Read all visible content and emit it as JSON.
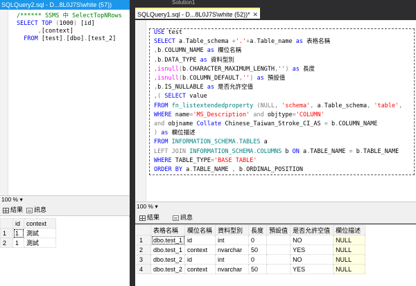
{
  "left_pane": {
    "tab_title": "SQLQuery2.sql - D...8L0J7S\\white (57))",
    "code": [
      [
        {
          "t": "/****** SSMS 中 SelectTopNRows",
          "c": "cm"
        }
      ],
      [
        {
          "t": "SELECT TOP ",
          "c": "kw"
        },
        {
          "t": "(",
          "c": "gr"
        },
        {
          "t": "1000",
          "c": "txt"
        },
        {
          "t": ") ",
          "c": "gr"
        },
        {
          "t": "[id]",
          "c": "txt"
        }
      ],
      [
        {
          "t": "      ,",
          "c": "gr"
        },
        {
          "t": "[context]",
          "c": "txt"
        }
      ],
      [
        {
          "t": "  FROM ",
          "c": "kw"
        },
        {
          "t": "[test]",
          "c": "txt"
        },
        {
          "t": ".",
          "c": "gr"
        },
        {
          "t": "[dbo]",
          "c": "txt"
        },
        {
          "t": ".",
          "c": "gr"
        },
        {
          "t": "[test_2]",
          "c": "txt"
        }
      ]
    ],
    "zoom": "100 %",
    "results_tab": "結果",
    "messages_tab": "訊息",
    "grid": {
      "columns": [
        "id",
        "context"
      ],
      "rows": [
        [
          "1",
          "1",
          "測試"
        ],
        [
          "2",
          "1",
          "測試"
        ]
      ]
    }
  },
  "right_pane": {
    "window_title": "Solution1",
    "tab_title": "SQLQuery1.sql - D...8L0J7S\\white (52))*",
    "tab_close": "✕",
    "code": [
      [
        {
          "t": "USE ",
          "c": "kw"
        },
        {
          "t": "test",
          "c": "txt"
        }
      ],
      [
        {
          "t": "SELECT ",
          "c": "kw"
        },
        {
          "t": "a",
          "c": "txt"
        },
        {
          "t": ".",
          "c": "gr"
        },
        {
          "t": "Table_schema ",
          "c": "txt"
        },
        {
          "t": "+",
          "c": "gr"
        },
        {
          "t": "'.'",
          "c": "str"
        },
        {
          "t": "+",
          "c": "gr"
        },
        {
          "t": "a",
          "c": "txt"
        },
        {
          "t": ".",
          "c": "gr"
        },
        {
          "t": "Table_name ",
          "c": "txt"
        },
        {
          "t": "as ",
          "c": "kw"
        },
        {
          "t": "表格名稱",
          "c": "txt"
        }
      ],
      [
        {
          "t": ",",
          "c": "gr"
        },
        {
          "t": "b",
          "c": "txt"
        },
        {
          "t": ".",
          "c": "gr"
        },
        {
          "t": "COLUMN_NAME ",
          "c": "txt"
        },
        {
          "t": "as ",
          "c": "kw"
        },
        {
          "t": "欄位名稱",
          "c": "txt"
        }
      ],
      [
        {
          "t": ",",
          "c": "gr"
        },
        {
          "t": "b",
          "c": "txt"
        },
        {
          "t": ".",
          "c": "gr"
        },
        {
          "t": "DATA_TYPE ",
          "c": "txt"
        },
        {
          "t": "as ",
          "c": "kw"
        },
        {
          "t": "資料型別",
          "c": "txt"
        }
      ],
      [
        {
          "t": ",",
          "c": "gr"
        },
        {
          "t": "isnull",
          "c": "fn"
        },
        {
          "t": "(",
          "c": "gr"
        },
        {
          "t": "b",
          "c": "txt"
        },
        {
          "t": ".",
          "c": "gr"
        },
        {
          "t": "CHARACTER_MAXIMUM_LENGTH",
          "c": "txt"
        },
        {
          "t": ",",
          "c": "gr"
        },
        {
          "t": "''",
          "c": "str"
        },
        {
          "t": ") ",
          "c": "gr"
        },
        {
          "t": "as ",
          "c": "kw"
        },
        {
          "t": "長度",
          "c": "txt"
        }
      ],
      [
        {
          "t": ",",
          "c": "gr"
        },
        {
          "t": "isnull",
          "c": "fn"
        },
        {
          "t": "(",
          "c": "gr"
        },
        {
          "t": "b",
          "c": "txt"
        },
        {
          "t": ".",
          "c": "gr"
        },
        {
          "t": "COLUMN_DEFAULT",
          "c": "txt"
        },
        {
          "t": ",",
          "c": "gr"
        },
        {
          "t": "''",
          "c": "str"
        },
        {
          "t": ") ",
          "c": "gr"
        },
        {
          "t": "as ",
          "c": "kw"
        },
        {
          "t": "預設值",
          "c": "txt"
        }
      ],
      [
        {
          "t": ",",
          "c": "gr"
        },
        {
          "t": "b",
          "c": "txt"
        },
        {
          "t": ".",
          "c": "gr"
        },
        {
          "t": "IS_NULLABLE ",
          "c": "txt"
        },
        {
          "t": "as ",
          "c": "kw"
        },
        {
          "t": "是否允許空值",
          "c": "txt"
        }
      ],
      [
        {
          "t": ",",
          "c": "gr"
        },
        {
          "t": "( ",
          "c": "gr"
        },
        {
          "t": "SELECT ",
          "c": "kw"
        },
        {
          "t": "value",
          "c": "txt"
        }
      ],
      [
        {
          "t": "FROM ",
          "c": "kw"
        },
        {
          "t": "fn_listextendedproperty ",
          "c": "sys"
        },
        {
          "t": "(",
          "c": "gr"
        },
        {
          "t": "NULL",
          "c": "gr"
        },
        {
          "t": ", ",
          "c": "gr"
        },
        {
          "t": "'schema'",
          "c": "str"
        },
        {
          "t": ", ",
          "c": "gr"
        },
        {
          "t": "a",
          "c": "txt"
        },
        {
          "t": ".",
          "c": "gr"
        },
        {
          "t": "Table_schema",
          "c": "txt"
        },
        {
          "t": ", ",
          "c": "gr"
        },
        {
          "t": "'table'",
          "c": "str"
        },
        {
          "t": ",",
          "c": "gr"
        }
      ],
      [
        {
          "t": "WHERE ",
          "c": "kw"
        },
        {
          "t": "name",
          "c": "txt"
        },
        {
          "t": "=",
          "c": "gr"
        },
        {
          "t": "'MS_Description'",
          "c": "str"
        },
        {
          "t": " and ",
          "c": "gr"
        },
        {
          "t": "objtype",
          "c": "txt"
        },
        {
          "t": "=",
          "c": "gr"
        },
        {
          "t": "'COLUMN'",
          "c": "str"
        }
      ],
      [
        {
          "t": "and ",
          "c": "gr"
        },
        {
          "t": "objname ",
          "c": "txt"
        },
        {
          "t": "Collate ",
          "c": "kw"
        },
        {
          "t": "Chinese_Taiwan_Stroke_CI_AS ",
          "c": "txt"
        },
        {
          "t": "= ",
          "c": "gr"
        },
        {
          "t": "b",
          "c": "txt"
        },
        {
          "t": ".",
          "c": "gr"
        },
        {
          "t": "COLUMN_NAME",
          "c": "txt"
        }
      ],
      [
        {
          "t": ") ",
          "c": "gr"
        },
        {
          "t": "as ",
          "c": "kw"
        },
        {
          "t": "欄位描述",
          "c": "txt"
        }
      ],
      [
        {
          "t": "FROM ",
          "c": "kw"
        },
        {
          "t": "INFORMATION_SCHEMA",
          "c": "sys"
        },
        {
          "t": ".",
          "c": "gr"
        },
        {
          "t": "TABLES ",
          "c": "sys"
        },
        {
          "t": "a",
          "c": "txt"
        }
      ],
      [
        {
          "t": "LEFT JOIN ",
          "c": "gr"
        },
        {
          "t": "INFORMATION_SCHEMA",
          "c": "sys"
        },
        {
          "t": ".",
          "c": "gr"
        },
        {
          "t": "COLUMNS ",
          "c": "sys"
        },
        {
          "t": "b ",
          "c": "txt"
        },
        {
          "t": "ON ",
          "c": "kw"
        },
        {
          "t": "a",
          "c": "txt"
        },
        {
          "t": ".",
          "c": "gr"
        },
        {
          "t": "TABLE_NAME ",
          "c": "txt"
        },
        {
          "t": "= ",
          "c": "gr"
        },
        {
          "t": "b",
          "c": "txt"
        },
        {
          "t": ".",
          "c": "gr"
        },
        {
          "t": "TABLE_NAME",
          "c": "txt"
        }
      ],
      [
        {
          "t": "WHERE ",
          "c": "kw"
        },
        {
          "t": "TABLE_TYPE",
          "c": "txt"
        },
        {
          "t": "=",
          "c": "gr"
        },
        {
          "t": "'BASE TABLE'",
          "c": "str"
        }
      ],
      [
        {
          "t": "ORDER BY ",
          "c": "kw"
        },
        {
          "t": "a",
          "c": "txt"
        },
        {
          "t": ".",
          "c": "gr"
        },
        {
          "t": "TABLE_NAME ",
          "c": "txt"
        },
        {
          "t": ", ",
          "c": "gr"
        },
        {
          "t": "b",
          "c": "txt"
        },
        {
          "t": ".",
          "c": "gr"
        },
        {
          "t": "ORDINAL_POSITION",
          "c": "txt"
        }
      ]
    ],
    "zoom": "100 %",
    "results_tab": "結果",
    "messages_tab": "訊息",
    "grid": {
      "columns": [
        "表格名稱",
        "欄位名稱",
        "資料型別",
        "長度",
        "預設值",
        "是否允許空值",
        "欄位描述"
      ],
      "rows": [
        [
          "1",
          "dbo.test_1",
          "id",
          "int",
          "0",
          "",
          "NO",
          "NULL"
        ],
        [
          "2",
          "dbo.test_1",
          "context",
          "nvarchar",
          "50",
          "",
          "YES",
          "NULL"
        ],
        [
          "3",
          "dbo.test_2",
          "id",
          "int",
          "0",
          "",
          "NO",
          "NULL"
        ],
        [
          "4",
          "dbo.test_2",
          "context",
          "nvarchar",
          "50",
          "",
          "YES",
          "NULL"
        ]
      ]
    }
  },
  "colors": {
    "keyword": "#0000ff",
    "string": "#ff0000",
    "function": "#ff00ff",
    "system_object": "#008080",
    "operator": "#808080",
    "comment": "#008000",
    "active_tab": "#1c97ea",
    "null_cell": "#ffffe1"
  }
}
